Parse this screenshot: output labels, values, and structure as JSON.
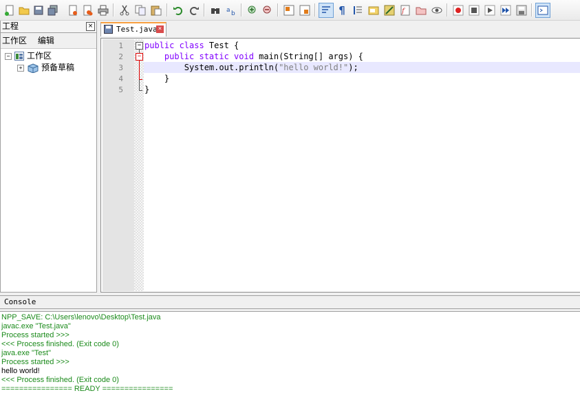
{
  "toolbar": {
    "icons": [
      "new-file-icon",
      "open-file-icon",
      "save-icon",
      "save-all-icon",
      "close-icon",
      "close-all-icon",
      "print-icon",
      "cut-icon",
      "copy-icon",
      "paste-icon",
      "undo-icon",
      "redo-icon",
      "find-icon",
      "replace-icon",
      "zoom-in-icon",
      "zoom-out-icon",
      "sync-vertical-icon",
      "sync-horizontal-icon",
      "word-wrap-icon",
      "show-all-chars-icon",
      "indent-guide-icon",
      "user-lang-icon",
      "doc-map-icon",
      "function-list-icon",
      "folder-workspace-icon",
      "monitor-icon",
      "record-macro-icon",
      "stop-macro-icon",
      "play-macro-icon",
      "run-macro-multiple-icon",
      "save-macro-icon",
      "console-icon"
    ]
  },
  "project": {
    "title": "工程",
    "close": "×",
    "menu": [
      "工作区",
      "编辑"
    ],
    "tree": [
      {
        "expander": "−",
        "label": "工作区"
      },
      {
        "expander": "+",
        "label": "预备草稿"
      }
    ]
  },
  "editor": {
    "tab_label": "Test.java",
    "tab_close": "×",
    "line_numbers": [
      "1",
      "2",
      "3",
      "4",
      "5"
    ],
    "lines": [
      {
        "kw": "public class",
        "rest": " Test {"
      },
      {
        "indent": "    ",
        "kw": "public static void",
        "rest": " main(String[] args) {"
      },
      {
        "pre": "        System.out.println(",
        "str": "\"hello world!\"",
        "post": ");"
      },
      {
        "text": "    }"
      },
      {
        "text": "}"
      }
    ],
    "current_line": 3
  },
  "console": {
    "title": "Console",
    "lines": [
      {
        "text": "NPP_SAVE: C:\\Users\\lenovo\\Desktop\\Test.java",
        "color": "#1a8a1a"
      },
      {
        "text": "javac.exe \"Test.java\"",
        "color": "#1a8a1a"
      },
      {
        "text": "Process started >>>",
        "color": "#1a8a1a"
      },
      {
        "text": "<<< Process finished. (Exit code 0)",
        "color": "#1a8a1a"
      },
      {
        "text": "java.exe \"Test\"",
        "color": "#1a8a1a"
      },
      {
        "text": "Process started >>>",
        "color": "#1a8a1a"
      },
      {
        "text": "hello world!",
        "color": "#000000"
      },
      {
        "text": "<<< Process finished. (Exit code 0)",
        "color": "#1a8a1a"
      },
      {
        "text": "================ READY ================",
        "color": "#1a8a1a"
      }
    ]
  },
  "colors": {
    "keyword": "#8000ff",
    "string": "#808080",
    "current_line": "#e8e8ff",
    "console_green": "#1a8a1a",
    "tab_accent": "#f9a040"
  }
}
